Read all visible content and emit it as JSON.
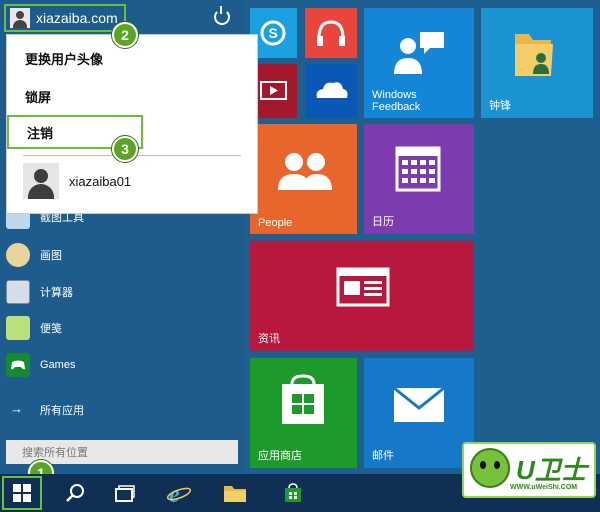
{
  "user": {
    "name": "xiazaiba.com"
  },
  "dropdown": {
    "items": [
      {
        "label": "更换用户头像"
      },
      {
        "label": "锁屏"
      },
      {
        "label": "注销"
      }
    ],
    "other_user": "xiazaiba01"
  },
  "badges": [
    "1",
    "2",
    "3"
  ],
  "list": {
    "items": [
      {
        "label": "截图工具",
        "icon": "scissors-icon"
      },
      {
        "label": "画图",
        "icon": "paint-icon"
      },
      {
        "label": "计算器",
        "icon": "calculator-icon"
      },
      {
        "label": "便笺",
        "icon": "sticky-notes-icon"
      },
      {
        "label": "Games",
        "icon": "games-icon"
      }
    ],
    "all_apps": "所有应用"
  },
  "search": {
    "placeholder": "搜索所有位置"
  },
  "tiles": {
    "windows_feedback": "Windows\nFeedback",
    "zhongfeng": "钟锋",
    "people": "People",
    "calendar": "日历",
    "news": "资讯",
    "store": "应用商店",
    "mail": "邮件"
  },
  "logo": {
    "text": "U卫士",
    "url": "WWW.uWeiShi.COM"
  },
  "colors": {
    "accent_green": "#6abf3b",
    "skype_tile": "#1ba1e2",
    "music_tile": "#e8463d",
    "video_tile": "#a4182e",
    "onedrive_tile": "#0a58b6",
    "feedback_tile": "#1585d8",
    "folder_tile": "#1b92d1",
    "people_tile": "#e8652c",
    "calendar_tile": "#7c3caf",
    "news_tile": "#b8183e",
    "store_tile": "#1c9b2a",
    "mail_tile": "#1578c9"
  }
}
